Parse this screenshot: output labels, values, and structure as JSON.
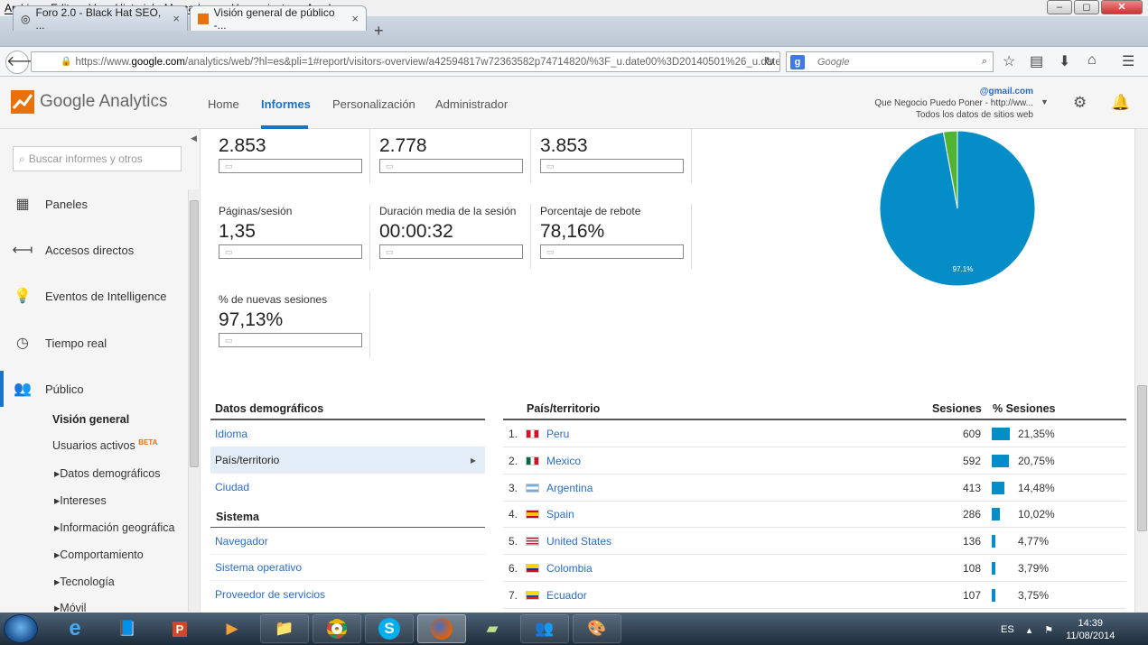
{
  "menubar": [
    "Archivo",
    "Editar",
    "Ver",
    "Historial",
    "Marcadores",
    "Herramientas",
    "Ayuda"
  ],
  "window_controls": {
    "minimize": "–",
    "maximize": "◻",
    "close": "✕"
  },
  "tabs": [
    {
      "title": "Foro 2.0 - Black Hat SEO, ...",
      "close": "×"
    },
    {
      "title": "Visión general de público -...",
      "close": "×"
    }
  ],
  "new_tab": "+",
  "url": {
    "prefix": "https://www.",
    "domain": "google.com",
    "path": "/analytics/web/?hl=es&pli=1#report/visitors-overview/a42594817w72363582p74714820/%3F_u.date00%3D20140501%26_u.date"
  },
  "search": {
    "placeholder": "Google",
    "engine": "g"
  },
  "ga": {
    "logo_text": "Google Analytics",
    "nav": [
      "Home",
      "Informes",
      "Personalización",
      "Administrador"
    ],
    "account": {
      "email": "@gmail.com",
      "property": "Que Negocio Puedo Poner - http://ww...",
      "view": "Todos los datos de sitios web"
    }
  },
  "sidebar": {
    "search_placeholder": "Buscar informes y otros",
    "items": [
      {
        "label": "Paneles",
        "icon": "grid-icon"
      },
      {
        "label": "Accesos directos",
        "icon": "shortcut-arrow-icon"
      },
      {
        "label": "Eventos de Intelligence",
        "icon": "lightbulb-icon"
      },
      {
        "label": "Tiempo real",
        "icon": "clock-icon"
      },
      {
        "label": "Público",
        "icon": "people-icon"
      }
    ],
    "sub": {
      "vision": "Visión general",
      "usuarios": "Usuarios activos",
      "beta": "BETA",
      "children": [
        "Datos demográficos",
        "Intereses",
        "Información geográfica",
        "Comportamiento",
        "Tecnología",
        "Móvil"
      ]
    }
  },
  "metrics": {
    "row1": [
      "2.853",
      "2.778",
      "3.853"
    ],
    "row2": [
      {
        "label": "Páginas/sesión",
        "value": "1,35"
      },
      {
        "label": "Duración media de la sesión",
        "value": "00:00:32"
      },
      {
        "label": "Porcentaje de rebote",
        "value": "78,16%"
      }
    ],
    "row3": [
      {
        "label": "% de nuevas sesiones",
        "value": "97,13%"
      }
    ]
  },
  "chart_data": {
    "type": "pie",
    "slices": [
      {
        "value": 97.1,
        "color": "#058dc7",
        "label": "97.1%"
      },
      {
        "value": 2.9,
        "color": "#50b432"
      }
    ]
  },
  "left_table": {
    "heading1": "Datos demográficos",
    "items1": [
      "Idioma",
      "País/territorio",
      "Ciudad"
    ],
    "heading2": "Sistema",
    "items2": [
      "Navegador",
      "Sistema operativo",
      "Proveedor de servicios"
    ]
  },
  "country_table": {
    "headers": [
      "País/territorio",
      "Sesiones",
      "% Sesiones"
    ],
    "rows": [
      {
        "idx": "1.",
        "country": "Peru",
        "sessions": "609",
        "pct": "21,35%",
        "share": 21.35
      },
      {
        "idx": "2.",
        "country": "Mexico",
        "sessions": "592",
        "pct": "20,75%",
        "share": 20.75
      },
      {
        "idx": "3.",
        "country": "Argentina",
        "sessions": "413",
        "pct": "14,48%",
        "share": 14.48
      },
      {
        "idx": "4.",
        "country": "Spain",
        "sessions": "286",
        "pct": "10,02%",
        "share": 10.02
      },
      {
        "idx": "5.",
        "country": "United States",
        "sessions": "136",
        "pct": "4,77%",
        "share": 4.77
      },
      {
        "idx": "6.",
        "country": "Colombia",
        "sessions": "108",
        "pct": "3,79%",
        "share": 3.79
      },
      {
        "idx": "7.",
        "country": "Ecuador",
        "sessions": "107",
        "pct": "3,75%",
        "share": 3.75
      }
    ]
  },
  "taskbar": {
    "lang": "ES",
    "time": "14:39",
    "date": "11/08/2014"
  },
  "colors": {
    "accent": "#1a73c9",
    "bar": "#058dc7",
    "link": "#2b6cc4"
  }
}
